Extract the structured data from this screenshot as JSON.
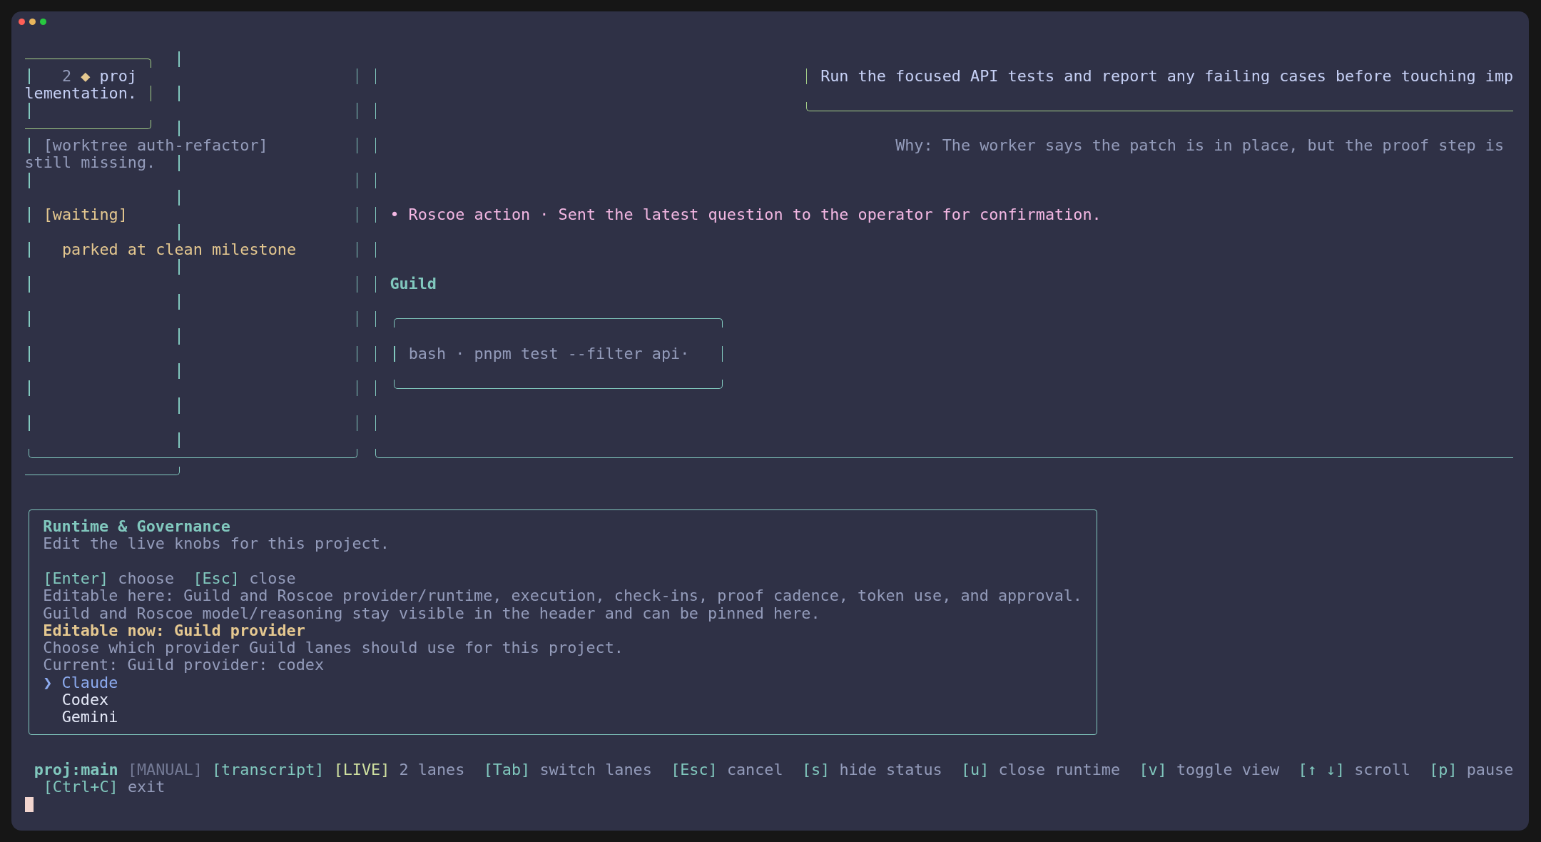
{
  "lane_list": {
    "card": {
      "number": "2",
      "marker": "◆",
      "name": "proj",
      "wrapped_text": "lementation."
    },
    "worktree": "[worktree auth-refactor]",
    "wrapped_text": "still missing.",
    "status": "[waiting]",
    "status_note": "parked at clean milestone"
  },
  "transcript": {
    "prompt": "Run the focused API tests and report any failing cases before touching imp",
    "reason": "Why: The worker says the patch is in place, but the proof step is",
    "event": "• Roscoe action · Sent the latest question to the operator for confirmation.",
    "lane_heading": "Guild",
    "tool_call": "bash · pnpm test --filter api·"
  },
  "runtime_panel": {
    "title": "Runtime & Governance",
    "subtitle": "Edit the live knobs for this project.",
    "key_hints": [
      {
        "key": "[Enter]",
        "action": "choose"
      },
      {
        "key": "[Esc]",
        "action": "close"
      }
    ],
    "notes": [
      "Editable here: Guild and Roscoe provider/runtime, execution, check-ins, proof cadence, token use, and approval.",
      "Guild and Roscoe model/reasoning stay visible in the header and can be pinned here."
    ],
    "editing": "Editable now: Guild provider",
    "question": "Choose which provider Guild lanes should use for this project.",
    "current": "Current: Guild provider: codex",
    "pointer": "❯",
    "options": [
      {
        "label": "Claude",
        "selected": true
      },
      {
        "label": "Codex",
        "selected": false
      },
      {
        "label": "Gemini",
        "selected": false
      }
    ]
  },
  "status_bar": {
    "project": "proj:main",
    "tags": [
      {
        "kind": "mode",
        "label": "[MANUAL]"
      },
      {
        "kind": "view",
        "label": "[transcript]"
      },
      {
        "kind": "live",
        "label": "[LIVE]"
      }
    ],
    "lanes": "2 lanes",
    "shortcuts": [
      {
        "key": "[Tab]",
        "action": "switch lanes"
      },
      {
        "key": "[Esc]",
        "action": "cancel"
      },
      {
        "key": "[s]",
        "action": "hide status"
      },
      {
        "key": "[u]",
        "action": "close runtime"
      },
      {
        "key": "[v]",
        "action": "toggle view"
      },
      {
        "key": "[↑ ↓]",
        "action": "scroll"
      },
      {
        "key": "[p]",
        "action": "pause"
      },
      {
        "key": "[Ctrl+C]",
        "action": "exit"
      }
    ]
  }
}
